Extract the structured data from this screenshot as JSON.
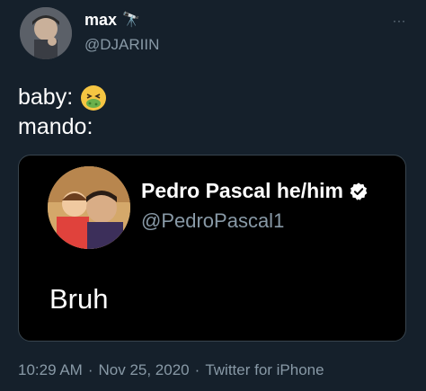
{
  "author": {
    "name": "max",
    "name_emoji": "🔭",
    "handle": "@DJARIIN"
  },
  "menu": {
    "more_icon": "···"
  },
  "tweet": {
    "line1": "baby:",
    "line1_emoji": "nauseated-face-icon",
    "line2": "mando:"
  },
  "quote": {
    "name": "Pedro Pascal he/him",
    "handle": "@PedroPascal1",
    "text": "Bruh"
  },
  "meta": {
    "time": "10:29 AM",
    "sep1": "·",
    "date": "Nov 25, 2020",
    "sep2": "·",
    "source": "Twitter for iPhone"
  },
  "colors": {
    "background": "#15202b",
    "quote_background": "#000000",
    "secondary_text": "#8899a6",
    "border": "#38444d"
  }
}
